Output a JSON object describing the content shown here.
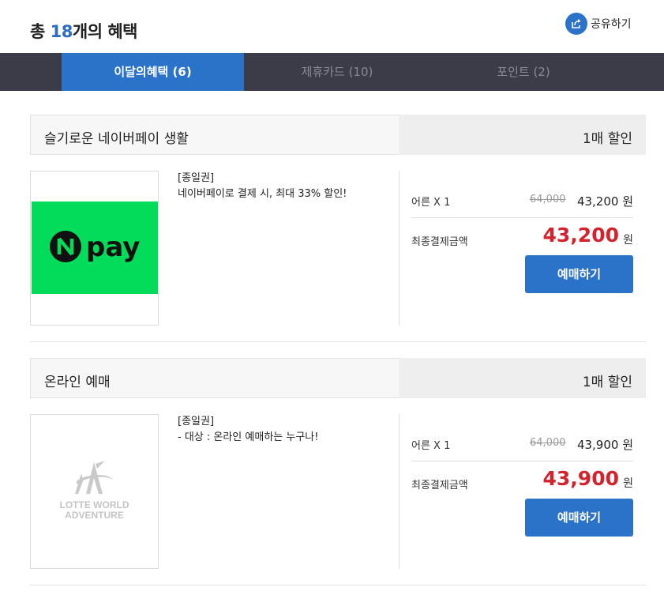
{
  "header": {
    "title_prefix": "총 ",
    "title_count": "18",
    "title_suffix": "개의 혜택",
    "share_label": "공유하기",
    "share_icon": "share-icon"
  },
  "tabs": [
    {
      "label": "이달의혜택 (6)",
      "active": true
    },
    {
      "label": "제휴카드 (10)",
      "active": false
    },
    {
      "label": "포인트 (2)",
      "active": false
    }
  ],
  "colors": {
    "brand_blue": "#2b72c9",
    "tab_bar": "#3c3c48",
    "price_red": "#d3242e",
    "npay_green": "#03dc5a"
  },
  "cards": [
    {
      "title": "슬기로운 네이버페이 생활",
      "discount": "1매 할인",
      "image_text": "pay",
      "desc_line1": "[종일권]",
      "desc_line2": "네이버페이로 결제 시, 최대 33% 할인!",
      "ticket_label": "어른 X 1",
      "original_price": "64,000",
      "sale_price": "43,200 원",
      "final_label": "최종결제금액",
      "final_amount": "43,200",
      "final_unit": "원",
      "button_label": "예매하기"
    },
    {
      "title": "온라인 예매",
      "discount": "1매 할인",
      "image_text_line1": "LOTTE WORLD",
      "image_text_line2": "ADVENTURE",
      "desc_line1": "[종일권]",
      "desc_line2": "- 대상 : 온라인 예매하는 누구나!",
      "ticket_label": "어른 X 1",
      "original_price": "64,000",
      "sale_price": "43,900 원",
      "final_label": "최종결제금액",
      "final_amount": "43,900",
      "final_unit": "원",
      "button_label": "예매하기"
    }
  ]
}
